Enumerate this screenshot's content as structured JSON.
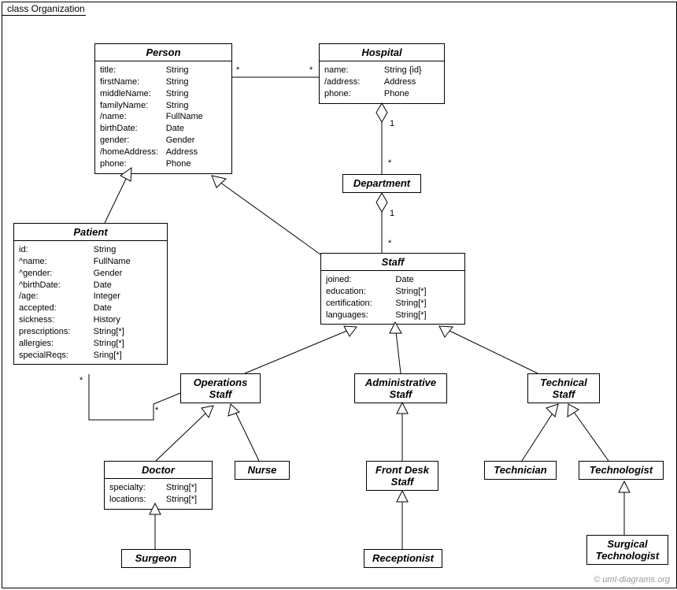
{
  "frame": {
    "title": "class Organization"
  },
  "classes": {
    "person": {
      "name": "Person",
      "attrs": [
        {
          "k": "title:",
          "v": "String"
        },
        {
          "k": "firstName:",
          "v": "String"
        },
        {
          "k": "middleName:",
          "v": "String"
        },
        {
          "k": "familyName:",
          "v": "String"
        },
        {
          "k": "/name:",
          "v": "FullName"
        },
        {
          "k": "birthDate:",
          "v": "Date"
        },
        {
          "k": "gender:",
          "v": "Gender"
        },
        {
          "k": "/homeAddress:",
          "v": "Address"
        },
        {
          "k": "phone:",
          "v": "Phone"
        }
      ]
    },
    "hospital": {
      "name": "Hospital",
      "attrs": [
        {
          "k": "name:",
          "v": "String {id}"
        },
        {
          "k": "/address:",
          "v": "Address"
        },
        {
          "k": "phone:",
          "v": "Phone"
        }
      ]
    },
    "department": {
      "name": "Department"
    },
    "patient": {
      "name": "Patient",
      "attrs": [
        {
          "k": "id:",
          "v": "String"
        },
        {
          "k": "^name:",
          "v": "FullName"
        },
        {
          "k": "^gender:",
          "v": "Gender"
        },
        {
          "k": "^birthDate:",
          "v": "Date"
        },
        {
          "k": "/age:",
          "v": "Integer"
        },
        {
          "k": "accepted:",
          "v": "Date"
        },
        {
          "k": "sickness:",
          "v": "History"
        },
        {
          "k": "prescriptions:",
          "v": "String[*]"
        },
        {
          "k": "allergies:",
          "v": "String[*]"
        },
        {
          "k": "specialReqs:",
          "v": "Sring[*]"
        }
      ]
    },
    "staff": {
      "name": "Staff",
      "attrs": [
        {
          "k": "joined:",
          "v": "Date"
        },
        {
          "k": "education:",
          "v": "String[*]"
        },
        {
          "k": "certification:",
          "v": "String[*]"
        },
        {
          "k": "languages:",
          "v": "String[*]"
        }
      ]
    },
    "opsStaff": {
      "name": "Operations",
      "sub": "Staff"
    },
    "adminStaff": {
      "name": "Administrative",
      "sub": "Staff"
    },
    "techStaff": {
      "name": "Technical",
      "sub": "Staff"
    },
    "doctor": {
      "name": "Doctor",
      "attrs": [
        {
          "k": "specialty:",
          "v": "String[*]"
        },
        {
          "k": "locations:",
          "v": "String[*]"
        }
      ]
    },
    "nurse": {
      "name": "Nurse"
    },
    "frontDesk": {
      "name": "Front Desk",
      "sub": "Staff"
    },
    "technician": {
      "name": "Technician"
    },
    "technologist": {
      "name": "Technologist"
    },
    "surgeon": {
      "name": "Surgeon"
    },
    "receptionist": {
      "name": "Receptionist"
    },
    "surgTech": {
      "name": "Surgical",
      "sub": "Technologist"
    }
  },
  "multiplicities": {
    "star1": "*",
    "star2": "*",
    "star3": "*",
    "star4": "*",
    "star5": "*",
    "one1": "1",
    "one2": "1"
  },
  "watermark": "© uml-diagrams.org"
}
